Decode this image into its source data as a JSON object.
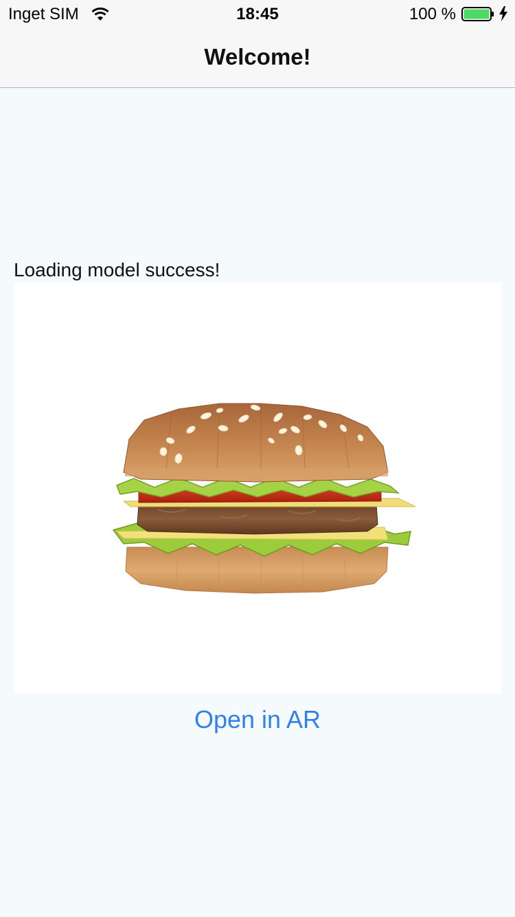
{
  "status_bar": {
    "carrier": "Inget SIM",
    "time": "18:45",
    "battery_percent": "100 %",
    "battery_level": 1.0,
    "battery_color": "#4cd964",
    "charging": true
  },
  "nav": {
    "title": "Welcome!"
  },
  "main": {
    "status_message": "Loading model success!",
    "model_viewer": {
      "model_icon": "hamburger-3d-model"
    },
    "ar_button_label": "Open in AR",
    "accent_color": "#2f80ed"
  }
}
